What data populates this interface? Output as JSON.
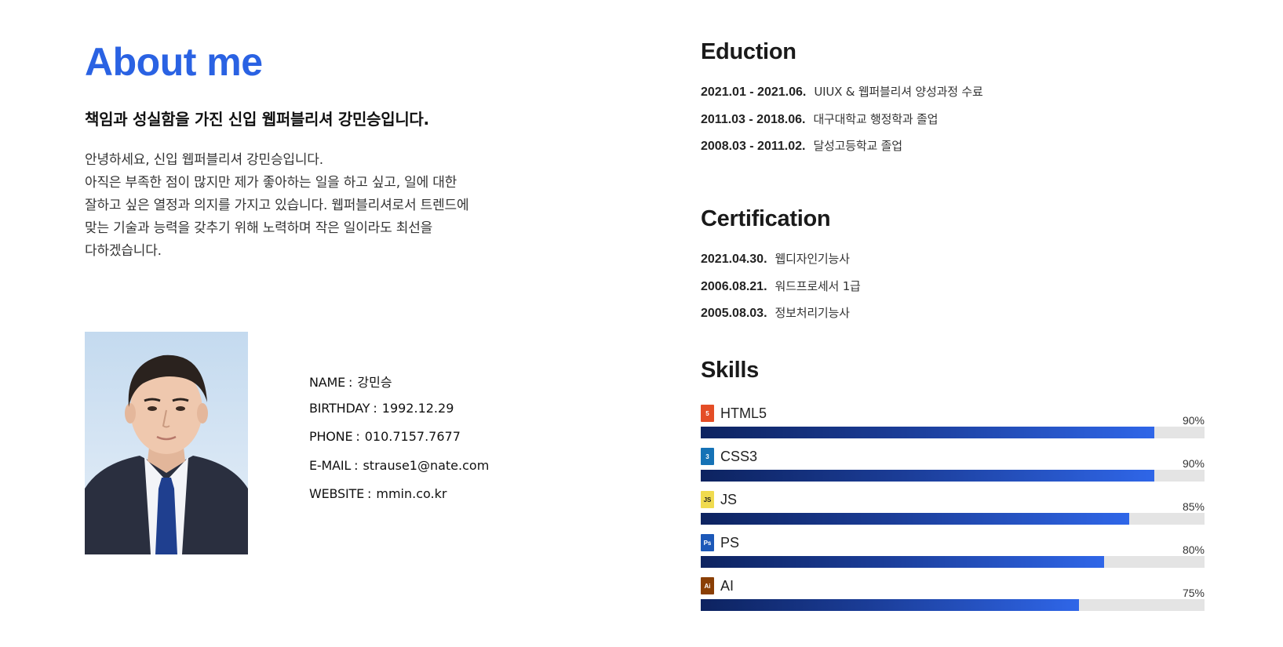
{
  "about": {
    "title": "About me",
    "tagline": "책임과 성실함을 가진 신입 웹퍼블리셔 강민승입니다.",
    "intro_lines": [
      "안녕하세요, 신입 웹퍼블리셔 강민승입니다.",
      "아직은 부족한 점이 많지만 제가 좋아하는 일을 하고 싶고, 일에 대한",
      "잘하고 싶은 열정과 의지를 가지고 있습니다. 웹퍼블리셔로서 트렌드에",
      "맞는 기술과 능력을 갖추기 위해 노력하며 작은 일이라도 최선을",
      "다하겠습니다."
    ]
  },
  "profile": {
    "rows": [
      {
        "key": "NAME",
        "sep": ":",
        "value": "강민승"
      },
      {
        "key": "BIRTHDAY",
        "sep": ":",
        "value": "1992.12.29"
      },
      {
        "key": "PHONE",
        "sep": ":",
        "value": "010.7157.7677"
      },
      {
        "key": "E-MAIL",
        "sep": ":",
        "value": "strause1@nate.com"
      },
      {
        "key": "WEBSITE",
        "sep": ":",
        "value": "mmin.co.kr"
      }
    ]
  },
  "education": {
    "title": "Eduction",
    "items": [
      {
        "date": "2021.01 - 2021.06.",
        "desc": "UIUX & 웹퍼블리셔 양성과정 수료"
      },
      {
        "date": "2011.03 - 2018.06.",
        "desc": "대구대학교 행정학과 졸업"
      },
      {
        "date": "2008.03 - 2011.02.",
        "desc": "달성고등학교 졸업"
      }
    ]
  },
  "certification": {
    "title": "Certification",
    "items": [
      {
        "date": "2021.04.30.",
        "desc": "웹디자인기능사"
      },
      {
        "date": "2006.08.21.",
        "desc": "워드프로세서 1급"
      },
      {
        "date": "2005.08.03.",
        "desc": "정보처리기능사"
      }
    ]
  },
  "skills": {
    "title": "Skills",
    "items": [
      {
        "name": "HTML5",
        "percent_label": "90%",
        "level": 0.9,
        "icon": "html5-icon",
        "icon_color": "#e44d26",
        "icon_text": "5"
      },
      {
        "name": "CSS3",
        "percent_label": "90%",
        "level": 0.9,
        "icon": "css3-icon",
        "icon_color": "#1572b6",
        "icon_text": "3"
      },
      {
        "name": "JS",
        "percent_label": "85%",
        "level": 0.85,
        "icon": "js-icon",
        "icon_color": "#f0db4f",
        "icon_text": "JS"
      },
      {
        "name": "PS",
        "percent_label": "80%",
        "level": 0.8,
        "icon": "photoshop-icon",
        "icon_color": "#1c58b8",
        "icon_text": "Ps"
      },
      {
        "name": "AI",
        "percent_label": "75%",
        "level": 0.75,
        "icon": "illustrator-icon",
        "icon_color": "#8a3f05",
        "icon_text": "Ai"
      }
    ]
  },
  "colors": {
    "accent": "#2a62e3",
    "bar_dark": "#0d2360",
    "bar_light": "#2f66e8",
    "bar_track": "#e4e4e4"
  }
}
